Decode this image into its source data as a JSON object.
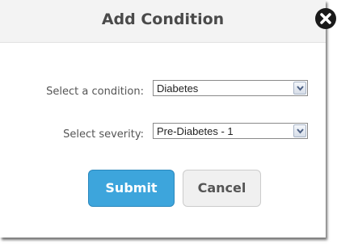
{
  "dialog": {
    "title": "Add Condition",
    "close_icon": "close-icon"
  },
  "form": {
    "condition_label": "Select a condition:",
    "condition_value": "Diabetes",
    "severity_label": "Select severity:",
    "severity_value": "Pre-Diabetes - 1"
  },
  "buttons": {
    "submit_label": "Submit",
    "cancel_label": "Cancel"
  },
  "colors": {
    "submit_bg": "#3da5dc",
    "cancel_bg": "#f0f0f0",
    "header_bg": "#f3f3f3"
  }
}
